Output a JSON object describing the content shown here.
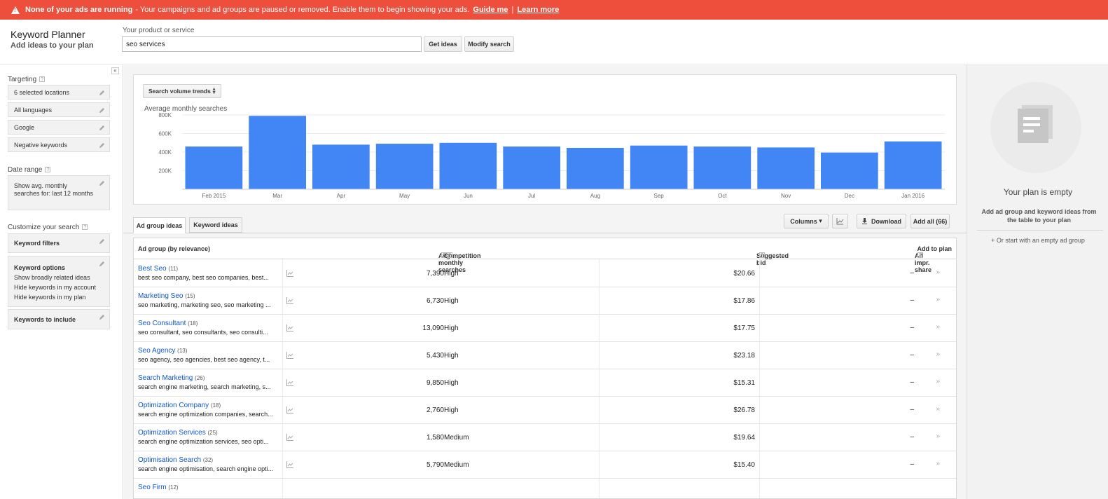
{
  "banner": {
    "title": "None of your ads are running",
    "message": "- Your campaigns and ad groups are paused or removed. Enable them to begin showing your ads.",
    "guide_link": "Guide me",
    "separator": "|",
    "learn_link": "Learn more"
  },
  "header": {
    "app_title": "Keyword Planner",
    "app_subtitle": "Add ideas to your plan",
    "product_label": "Your product or service",
    "product_value": "seo services",
    "get_ideas_label": "Get ideas",
    "modify_search_label": "Modify search"
  },
  "sidebar": {
    "collapse_label": "«",
    "targeting_label": "Targeting",
    "targeting_items": [
      "6 selected locations",
      "All languages",
      "Google",
      "Negative keywords"
    ],
    "date_range_label": "Date range",
    "date_range_value": "Show avg. monthly searches for: last 12 months",
    "customize_label": "Customize your search",
    "keyword_filters_label": "Keyword filters",
    "keyword_options_label": "Keyword options",
    "keyword_options_items": [
      "Show broadly related ideas",
      "Hide keywords in my account",
      "Hide keywords in my plan"
    ],
    "keywords_include_label": "Keywords to include",
    "help_glyph": "?"
  },
  "chart_data": {
    "type": "bar",
    "title": "Search volume trends",
    "ylabel": "Average monthly searches",
    "categories": [
      "Feb 2015",
      "Mar",
      "Apr",
      "May",
      "Jun",
      "Jul",
      "Aug",
      "Sep",
      "Oct",
      "Nov",
      "Dec",
      "Jan 2016"
    ],
    "values": [
      460000,
      790000,
      480000,
      490000,
      500000,
      460000,
      445000,
      470000,
      460000,
      450000,
      395000,
      515000
    ],
    "ytick_labels": [
      "800K",
      "600K",
      "400K",
      "200K"
    ],
    "yticks": [
      800000,
      600000,
      400000,
      200000
    ],
    "ylim": [
      0,
      800000
    ],
    "bar_color": "#4285f4",
    "grid": true
  },
  "tabs": {
    "ad_group_ideas": "Ad group ideas",
    "keyword_ideas": "Keyword ideas"
  },
  "toolbar": {
    "columns_label": "Columns",
    "columns_arrow": "▾",
    "download_label": "Download",
    "add_all_label": "Add all (66)"
  },
  "table": {
    "headers": {
      "ad_group": "Ad group (by relevance)",
      "searches": "Avg. monthly searches",
      "competition": "Competition",
      "bid": "Suggested bid",
      "share": "Ad impr. share",
      "add": "Add to plan"
    },
    "rows": [
      {
        "name": "Best Seo",
        "count": "(11)",
        "keywords": "best seo company, best seo companies, best...",
        "searches": "7,390",
        "competition": "High",
        "bid": "$20.66",
        "share": "–",
        "add": "»"
      },
      {
        "name": "Marketing Seo",
        "count": "(15)",
        "keywords": "seo marketing, marketing seo, seo marketing ...",
        "searches": "6,730",
        "competition": "High",
        "bid": "$17.86",
        "share": "–",
        "add": "»"
      },
      {
        "name": "Seo Consultant",
        "count": "(18)",
        "keywords": "seo consultant, seo consultants, seo consulti...",
        "searches": "13,090",
        "competition": "High",
        "bid": "$17.75",
        "share": "–",
        "add": "»"
      },
      {
        "name": "Seo Agency",
        "count": "(13)",
        "keywords": "seo agency, seo agencies, best seo agency, t...",
        "searches": "5,430",
        "competition": "High",
        "bid": "$23.18",
        "share": "–",
        "add": "»"
      },
      {
        "name": "Search Marketing",
        "count": "(26)",
        "keywords": "search engine marketing, search marketing, s...",
        "searches": "9,850",
        "competition": "High",
        "bid": "$15.31",
        "share": "–",
        "add": "»"
      },
      {
        "name": "Optimization Company",
        "count": "(18)",
        "keywords": "search engine optimization companies, search...",
        "searches": "2,760",
        "competition": "High",
        "bid": "$26.78",
        "share": "–",
        "add": "»"
      },
      {
        "name": "Optimization Services",
        "count": "(25)",
        "keywords": "search engine optimization services, seo opti...",
        "searches": "1,580",
        "competition": "Medium",
        "bid": "$19.64",
        "share": "–",
        "add": "»"
      },
      {
        "name": "Optimisation Search",
        "count": "(32)",
        "keywords": "search engine optimisation, search engine opti...",
        "searches": "5,790",
        "competition": "Medium",
        "bid": "$15.40",
        "share": "–",
        "add": "»"
      },
      {
        "name": "Seo Firm",
        "count": "(12)",
        "keywords": "",
        "searches": "",
        "competition": "",
        "bid": "",
        "share": "",
        "add": ""
      }
    ]
  },
  "plan": {
    "title": "Your plan is empty",
    "description": "Add ad group and keyword ideas from the table to your plan",
    "empty_group_link": "+ Or start with an empty ad group"
  },
  "colors": {
    "banner": "#ee4e3c",
    "link": "#1155cc",
    "bar": "#4285f4"
  }
}
